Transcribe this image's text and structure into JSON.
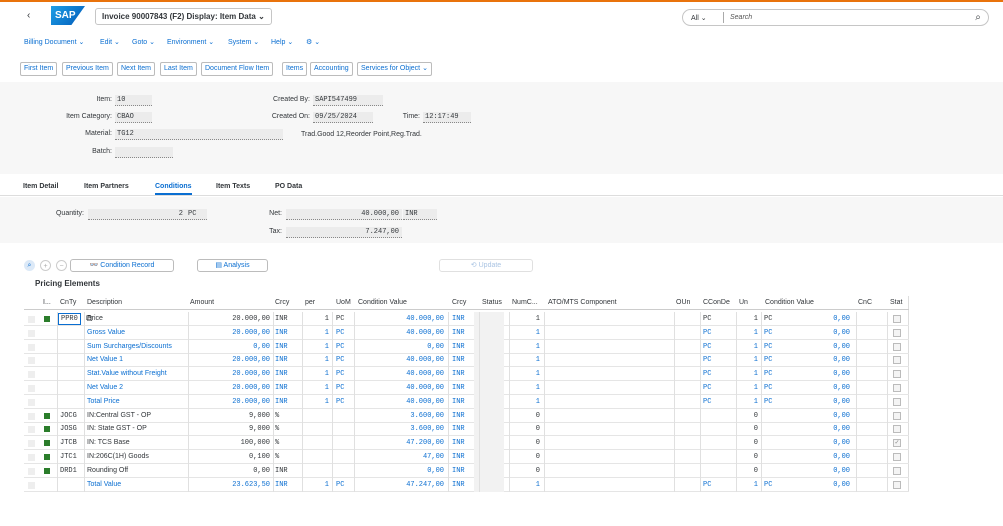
{
  "shell": {
    "title": "Invoice 90007843 (F2) Display: Item Data",
    "search_scope": "All",
    "search_placeholder": "Search"
  },
  "menu": [
    "Billing Document",
    "Edit",
    "Goto",
    "Environment",
    "System",
    "Help",
    "⚙"
  ],
  "toolbar": [
    "First Item",
    "Previous Item",
    "Next Item",
    "Last Item",
    "Document Flow Item",
    "Items",
    "Accounting",
    "Services for Object"
  ],
  "header": {
    "item_label": "Item:",
    "item_value": "10",
    "item_category_label": "Item Category:",
    "item_category_value": "CBAO",
    "material_label": "Material:",
    "material_value": "TG12",
    "batch_label": "Batch:",
    "batch_value": "",
    "created_by_label": "Created By:",
    "created_by_value": "SAPI547499",
    "created_on_label": "Created On:",
    "created_on_value": "09/25/2024",
    "time_label": "Time:",
    "time_value": "12:17:49",
    "material_desc": "Trad.Good 12,Reorder Point,Reg.Trad."
  },
  "tabs": [
    "Item Detail",
    "Item Partners",
    "Conditions",
    "Item Texts",
    "PO Data"
  ],
  "active_tab": "Conditions",
  "conditions": {
    "quantity_label": "Quantity:",
    "quantity_value": "2",
    "quantity_unit": "PC",
    "net_label": "Net:",
    "net_value": "40.000,00",
    "net_currency": "INR",
    "tax_label": "Tax:",
    "tax_value": "7.247,00"
  },
  "tools": {
    "condition_record": "Condition Record",
    "analysis": "Analysis",
    "update": "Update"
  },
  "pricing_title": "Pricing Elements",
  "columns": [
    "I...",
    "CnTy",
    "Description",
    "Amount",
    "Crcy",
    "per",
    "UoM",
    "Condition Value",
    "Crcy",
    "Status",
    "NumC...",
    "ATO/MTS Component",
    "OUn",
    "CConDe",
    "Un",
    "Condition Value",
    "CnC",
    "Stat"
  ],
  "rows": [
    {
      "led": true,
      "cnty": "PPR0",
      "desc": "Price",
      "amount": "20.000,00",
      "crcy": "INR",
      "per": "1",
      "uom": "PC",
      "cval": "40.000,00",
      "crcy2": "INR",
      "numc": "1",
      "oun": "PC",
      "ccon": "1",
      "un": "PC",
      "cval2": "0,00",
      "blue": false,
      "stat": ""
    },
    {
      "led": false,
      "cnty": "",
      "desc": "Gross Value",
      "amount": "20.000,00",
      "crcy": "INR",
      "per": "1",
      "uom": "PC",
      "cval": "40.000,00",
      "crcy2": "INR",
      "numc": "1",
      "oun": "PC",
      "ccon": "1",
      "un": "PC",
      "cval2": "0,00",
      "blue": true,
      "stat": ""
    },
    {
      "led": false,
      "cnty": "",
      "desc": "Sum Surcharges/Discounts",
      "amount": "0,00",
      "crcy": "INR",
      "per": "1",
      "uom": "PC",
      "cval": "0,00",
      "crcy2": "INR",
      "numc": "1",
      "oun": "PC",
      "ccon": "1",
      "un": "PC",
      "cval2": "0,00",
      "blue": true,
      "stat": ""
    },
    {
      "led": false,
      "cnty": "",
      "desc": "Net Value 1",
      "amount": "20.000,00",
      "crcy": "INR",
      "per": "1",
      "uom": "PC",
      "cval": "40.000,00",
      "crcy2": "INR",
      "numc": "1",
      "oun": "PC",
      "ccon": "1",
      "un": "PC",
      "cval2": "0,00",
      "blue": true,
      "stat": ""
    },
    {
      "led": false,
      "cnty": "",
      "desc": "Stat.Value without Freight",
      "amount": "20.000,00",
      "crcy": "INR",
      "per": "1",
      "uom": "PC",
      "cval": "40.000,00",
      "crcy2": "INR",
      "numc": "1",
      "oun": "PC",
      "ccon": "1",
      "un": "PC",
      "cval2": "0,00",
      "blue": true,
      "stat": ""
    },
    {
      "led": false,
      "cnty": "",
      "desc": "Net Value 2",
      "amount": "20.000,00",
      "crcy": "INR",
      "per": "1",
      "uom": "PC",
      "cval": "40.000,00",
      "crcy2": "INR",
      "numc": "1",
      "oun": "PC",
      "ccon": "1",
      "un": "PC",
      "cval2": "0,00",
      "blue": true,
      "stat": ""
    },
    {
      "led": false,
      "cnty": "",
      "desc": "Total Price",
      "amount": "20.000,00",
      "crcy": "INR",
      "per": "1",
      "uom": "PC",
      "cval": "40.000,00",
      "crcy2": "INR",
      "numc": "1",
      "oun": "PC",
      "ccon": "1",
      "un": "PC",
      "cval2": "0,00",
      "blue": true,
      "stat": ""
    },
    {
      "led": true,
      "cnty": "JOCG",
      "desc": "IN:Central GST - OP",
      "amount": "9,000",
      "crcy": "%",
      "per": "",
      "uom": "",
      "cval": "3.600,00",
      "crcy2": "INR",
      "numc": "0",
      "oun": "",
      "ccon": "0",
      "un": "",
      "cval2": "0,00",
      "blue": false,
      "stat": ""
    },
    {
      "led": true,
      "cnty": "JOSG",
      "desc": "IN: State GST - OP",
      "amount": "9,000",
      "crcy": "%",
      "per": "",
      "uom": "",
      "cval": "3.600,00",
      "crcy2": "INR",
      "numc": "0",
      "oun": "",
      "ccon": "0",
      "un": "",
      "cval2": "0,00",
      "blue": false,
      "stat": ""
    },
    {
      "led": true,
      "cnty": "JTCB",
      "desc": "IN: TCS Base",
      "amount": "100,000",
      "crcy": "%",
      "per": "",
      "uom": "",
      "cval": "47.200,00",
      "crcy2": "INR",
      "numc": "0",
      "oun": "",
      "ccon": "0",
      "un": "",
      "cval2": "0,00",
      "blue": false,
      "stat": "✓"
    },
    {
      "led": true,
      "cnty": "JTC1",
      "desc": "IN:206C(1H) Goods",
      "amount": "0,100",
      "crcy": "%",
      "per": "",
      "uom": "",
      "cval": "47,00",
      "crcy2": "INR",
      "numc": "0",
      "oun": "",
      "ccon": "0",
      "un": "",
      "cval2": "0,00",
      "blue": false,
      "stat": ""
    },
    {
      "led": true,
      "cnty": "DRD1",
      "desc": "Rounding Off",
      "amount": "0,00",
      "crcy": "INR",
      "per": "",
      "uom": "",
      "cval": "0,00",
      "crcy2": "INR",
      "numc": "0",
      "oun": "",
      "ccon": "0",
      "un": "",
      "cval2": "0,00",
      "blue": false,
      "stat": ""
    },
    {
      "led": false,
      "cnty": "",
      "desc": "Total Value",
      "amount": "23.623,50",
      "crcy": "INR",
      "per": "1",
      "uom": "PC",
      "cval": "47.247,00",
      "crcy2": "INR",
      "numc": "1",
      "oun": "PC",
      "ccon": "1",
      "un": "PC",
      "cval2": "0,00",
      "blue": true,
      "stat": ""
    }
  ]
}
